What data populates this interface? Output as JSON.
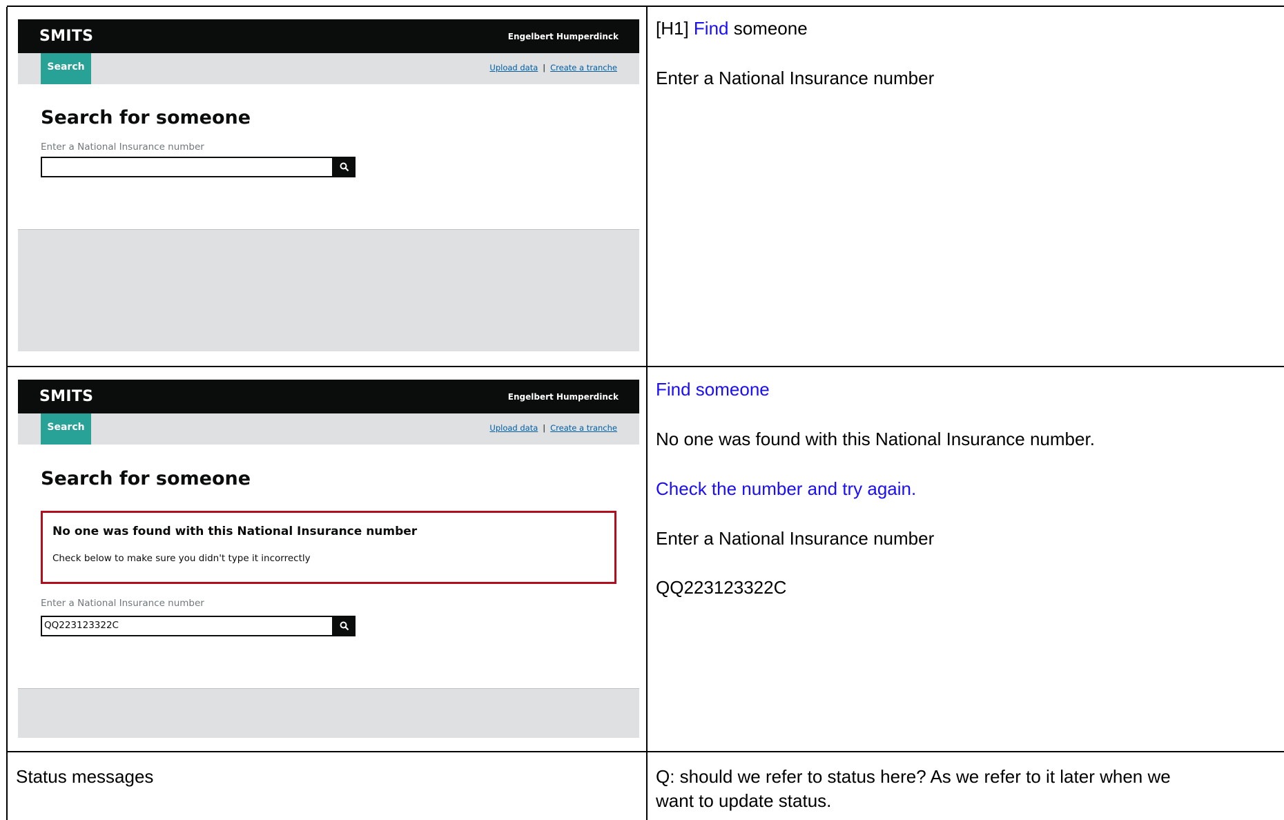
{
  "row1": {
    "mock": {
      "logo": "SMITS",
      "user": "Engelbert Humperdinck",
      "nav_tab": "Search",
      "link_upload": "Upload data",
      "link_separator": "|",
      "link_tranche": "Create a tranche",
      "heading": "Search for someone",
      "input_label": "Enter a National Insurance number",
      "input_value": ""
    },
    "notes": {
      "h1_tag": "[H1] ",
      "h1_link": "Find",
      "h1_rest": " someone",
      "line2": "Enter a National Insurance number"
    }
  },
  "row2": {
    "mock": {
      "logo": "SMITS",
      "user": "Engelbert Humperdinck",
      "nav_tab": "Search",
      "link_upload": "Upload data",
      "link_separator": "|",
      "link_tranche": "Create a tranche",
      "heading": "Search for someone",
      "error_title": "No one was found with this National Insurance number",
      "error_text": "Check below to make sure you didn't type it incorrectly",
      "input_label": "Enter a National Insurance number",
      "input_value": "QQ223123322C"
    },
    "notes": {
      "line1": "Find someone",
      "line2": "No one was found with this National Insurance number.",
      "line3": "Check the number and try again.",
      "line4": "Enter a National Insurance number",
      "line5": "QQ223123322C"
    }
  },
  "row3": {
    "left": "Status messages",
    "right_line1": "Q: should we refer to status here? As we refer to it later when we",
    "right_line2": "want to update status."
  },
  "colors": {
    "header_black": "#0b0c0c",
    "nav_grey": "#dee0e2",
    "tab_teal": "#28a197",
    "error_red": "#b10e1e",
    "link_blue": "#005ea5",
    "note_blue": "#1a0dff"
  }
}
